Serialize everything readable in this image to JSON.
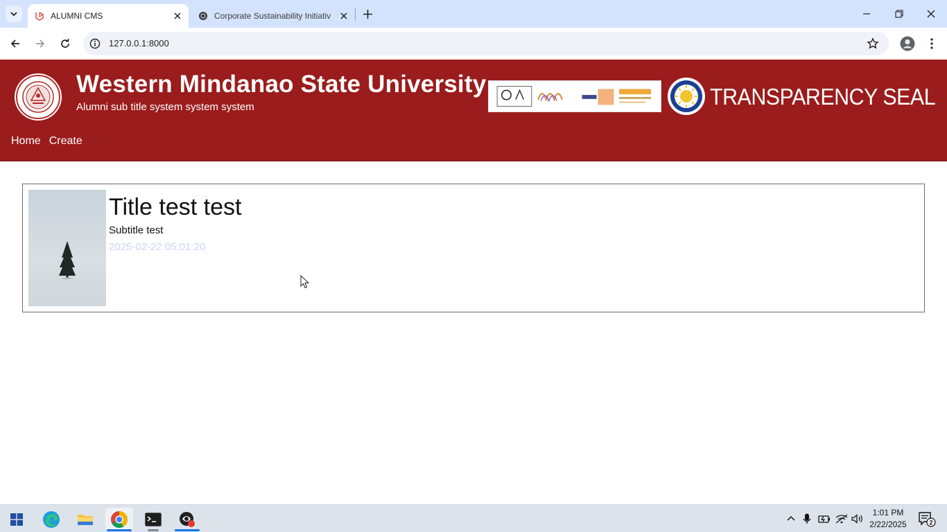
{
  "browser": {
    "tabs": [
      {
        "title": "ALUMNI CMS",
        "active": true
      },
      {
        "title": "Corporate Sustainability Initiativ",
        "active": false
      }
    ],
    "url": "127.0.0.1:8000"
  },
  "header": {
    "university_name": "Western Mindanao State University",
    "subtitle": "Alumni sub title system system system",
    "seal_text": "TRANSPARENCY SEAL",
    "accreditation_logos": [
      "ISO certification",
      "GCED",
      "WURI",
      "STARS"
    ],
    "nav": [
      {
        "label": "Home"
      },
      {
        "label": "Create"
      }
    ],
    "color": "#9b1c1c"
  },
  "posts": [
    {
      "title": "Title test test",
      "subtitle": "Subtitle test",
      "date": "2025-02-22 05:01:20",
      "thumbnail": "lone tree in snow"
    }
  ],
  "taskbar": {
    "apps": [
      "start-icon",
      "edge-icon",
      "file-explorer-icon",
      "chrome-icon",
      "terminal-icon",
      "app-icon"
    ],
    "time": "1:01 PM",
    "date": "2/22/2025"
  }
}
